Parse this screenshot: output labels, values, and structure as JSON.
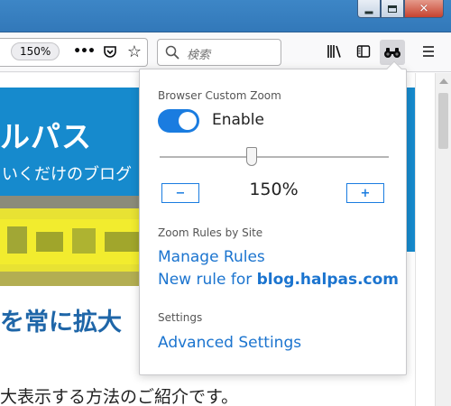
{
  "browser": {
    "zoom_indicator": "150%",
    "search_placeholder": "検索"
  },
  "page": {
    "header_title": "ルパス",
    "header_subtitle": "いくだけのブログ",
    "article_heading": "を常に拡大",
    "article_text": "大表示する方法のご紹介です。"
  },
  "panel": {
    "section_zoom": "Browser Custom Zoom",
    "enable_label": "Enable",
    "toggle_on": true,
    "zoom_value": "150%",
    "zoom_level_fraction": 0.4,
    "minus_label": "−",
    "plus_label": "+",
    "section_rules": "Zoom Rules by Site",
    "manage_rules": "Manage Rules",
    "new_rule_prefix": "New rule for ",
    "new_rule_domain": "blog.halpas.com",
    "section_settings": "Settings",
    "advanced_settings": "Advanced Settings"
  },
  "colors": {
    "accent": "#1a7ce0",
    "link": "#1b74cf",
    "site_header": "#168acd",
    "heading": "#1f66a8"
  }
}
